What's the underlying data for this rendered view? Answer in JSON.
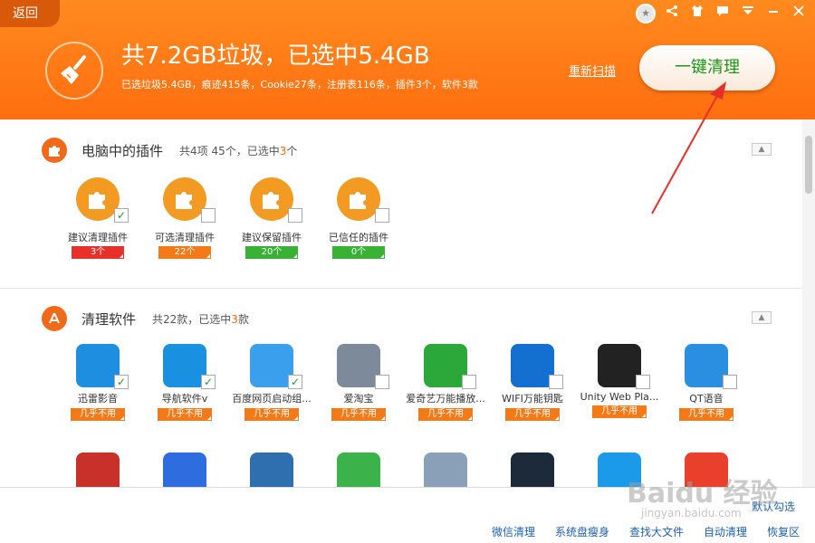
{
  "header": {
    "back": "返回",
    "headline": "共7.2GB垃圾，已选中5.4GB",
    "subline": "已选垃圾5.4GB，痕迹415条，Cookie27条，注册表116条，插件3个，软件3款",
    "rescan": "重新扫描",
    "clean_button": "一键清理",
    "icons": [
      "medal-icon",
      "share-icon",
      "skin-icon",
      "feedback-icon",
      "menu-icon",
      "minimize-icon",
      "close-icon"
    ]
  },
  "plugins_section": {
    "title": "电脑中的插件",
    "count_prefix": "共4项 45个，已选中",
    "count_num": "3",
    "count_suffix": "个",
    "items": [
      {
        "label": "建议清理插件",
        "badge": "3个",
        "color": "#e8302a",
        "checked": true
      },
      {
        "label": "可选清理插件",
        "badge": "22个",
        "color": "#f37a17",
        "checked": false
      },
      {
        "label": "建议保留插件",
        "badge": "20个",
        "color": "#39b135",
        "checked": false
      },
      {
        "label": "已信任的插件",
        "badge": "0个",
        "color": "#39b135",
        "checked": false
      }
    ]
  },
  "software_section": {
    "title": "清理软件",
    "count_prefix": "共22款，已选中",
    "count_num": "3",
    "count_suffix": "款",
    "usage_label": "几乎不用",
    "apps": [
      {
        "label": "迅雷影音",
        "checked": true,
        "icon": "xunlei-player-icon",
        "color": "#1e8fe0"
      },
      {
        "label": "导航软件v",
        "checked": true,
        "icon": "ie-browser-icon",
        "color": "#1a90e0"
      },
      {
        "label": "百度网页启动组...",
        "checked": true,
        "icon": "baidu-paw-icon",
        "color": "#3aa0ee"
      },
      {
        "label": "爱淘宝",
        "checked": false,
        "icon": "ai-taobao-icon",
        "color": "#7d8a99"
      },
      {
        "label": "爱奇艺万能播放...",
        "checked": false,
        "icon": "iqiyi-player-icon",
        "color": "#2aa839"
      },
      {
        "label": "WIFI万能钥匙",
        "checked": false,
        "icon": "wifi-key-icon",
        "color": "#1470d0"
      },
      {
        "label": "Unity Web Pla...",
        "checked": false,
        "icon": "unity-icon",
        "color": "#222222"
      },
      {
        "label": "QT语音",
        "checked": false,
        "icon": "qt-voice-icon",
        "color": "#2a8fe0"
      }
    ],
    "row2_icons": [
      {
        "icon": "red-app-icon",
        "color": "#c8302a"
      },
      {
        "icon": "baidu-du-icon",
        "color": "#2e6de0"
      },
      {
        "icon": "blue-orb-icon",
        "color": "#2f6fb0"
      },
      {
        "icon": "wechat-icon",
        "color": "#3cb34a"
      },
      {
        "icon": "disk-tool-icon",
        "color": "#8aa0b8"
      },
      {
        "icon": "lol-icon",
        "color": "#1c2a3a"
      },
      {
        "icon": "blue-app-icon",
        "color": "#1a9ae8"
      },
      {
        "icon": "video-app-icon",
        "color": "#e8402a"
      }
    ]
  },
  "footer": {
    "default_check": "默认勾选",
    "links": [
      "微信清理",
      "系统盘瘦身",
      "查找大文件",
      "自动清理",
      "恢复区"
    ]
  },
  "watermark": {
    "main": "Baidu 经验",
    "sub": "jingyan.baidu.com"
  }
}
